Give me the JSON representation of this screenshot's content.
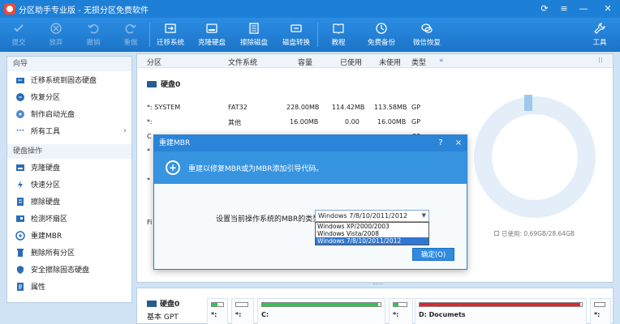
{
  "window": {
    "title": "分区助手专业版 - 无损分区免费软件"
  },
  "toolbar": {
    "items": [
      {
        "label": "提交",
        "icon": "check-icon",
        "disabled": true
      },
      {
        "label": "放弃",
        "icon": "cancel-icon",
        "disabled": true
      },
      {
        "label": "撤销",
        "icon": "undo-icon",
        "disabled": true
      },
      {
        "label": "重做",
        "icon": "redo-icon",
        "disabled": true
      },
      {
        "label": "迁移系统",
        "icon": "migrate-os-icon",
        "disabled": false
      },
      {
        "label": "克隆硬盘",
        "icon": "clone-disk-icon",
        "disabled": false
      },
      {
        "label": "擦除磁盘",
        "icon": "wipe-disk-icon",
        "disabled": false
      },
      {
        "label": "磁盘转换",
        "icon": "disk-convert-icon",
        "disabled": false
      },
      {
        "label": "教程",
        "icon": "tutorial-icon",
        "disabled": false
      },
      {
        "label": "免费备份",
        "icon": "backup-icon",
        "disabled": false
      },
      {
        "label": "微信恢复",
        "icon": "wechat-recover-icon",
        "disabled": false
      },
      {
        "label": "工具",
        "icon": "tools-icon",
        "disabled": false
      }
    ]
  },
  "sidebar": {
    "section1": "向导",
    "wizard_items": [
      {
        "label": "迁移系统到固态硬盘",
        "icon": "migrate-ssd-icon"
      },
      {
        "label": "恢复分区",
        "icon": "recover-partition-icon"
      },
      {
        "label": "制作启动光盘",
        "icon": "boot-disc-icon"
      },
      {
        "label": "所有工具",
        "icon": "more-icon",
        "chevron": "›"
      }
    ],
    "section2": "硬盘操作",
    "disk_items": [
      {
        "label": "克隆硬盘",
        "icon": "clone-disk-icon"
      },
      {
        "label": "快速分区",
        "icon": "quick-partition-icon"
      },
      {
        "label": "擦除硬盘",
        "icon": "wipe-disk-icon"
      },
      {
        "label": "检测坏扇区",
        "icon": "bad-sector-icon"
      },
      {
        "label": "重建MBR",
        "icon": "rebuild-mbr-icon"
      },
      {
        "label": "删除所有分区",
        "icon": "delete-all-icon"
      },
      {
        "label": "安全擦除固态硬盘",
        "icon": "secure-erase-icon"
      },
      {
        "label": "属性",
        "icon": "properties-icon"
      }
    ]
  },
  "table": {
    "headers": [
      "分区",
      "文件系统",
      "容量",
      "已使用",
      "未使用",
      "类型"
    ],
    "disk_label": "硬盘0",
    "rows": [
      {
        "partition": "*: SYSTEM",
        "fs": "FAT32",
        "capacity": "228.00MB",
        "used": "114.42MB",
        "free": "113.58MB",
        "type": "GP"
      },
      {
        "partition": "*:",
        "fs": "其他",
        "capacity": "16.00MB",
        "used": "0.00",
        "free": "16.00MB",
        "type": "GP"
      },
      {
        "partition": "C",
        "fs": "",
        "capacity": "",
        "used": "",
        "free": "",
        "type": "GP"
      },
      {
        "partition": "*",
        "fs": "",
        "capacity": "",
        "used": "",
        "free": "",
        "type": ""
      },
      {
        "partition": "*",
        "fs": "",
        "capacity": "",
        "used": "",
        "free": "",
        "type": ""
      },
      {
        "partition": "Fi",
        "fs": "",
        "capacity": "",
        "used": "",
        "free": "",
        "type": ""
      }
    ],
    "legend": "已使用: 0.69GB/28.64GB"
  },
  "dialog": {
    "title": "重建MBR",
    "help": "?",
    "close": "×",
    "banner": "重建以修复MBR或为MBR添加引导代码。",
    "label": "设置当前操作系统的MBR的类型:",
    "selected": "Windows 7/8/10/2011/2012",
    "options": [
      "Windows XP/2000/2003",
      "Windows Vista/2008",
      "Windows 7/8/10/2011/2012"
    ],
    "ok": "确定(O)"
  },
  "bottom": {
    "disk_name": "硬盘0",
    "disk_type": "基本 GPT",
    "parts": [
      {
        "label": "*:",
        "fill": 0.5,
        "color": "#2dc653"
      },
      {
        "label": "*:",
        "fill": 0,
        "color": "#2dc653"
      },
      {
        "label": "C:",
        "fill": 0.98,
        "color": "#2dc653"
      },
      {
        "label": "*:",
        "fill": 0.4,
        "color": "#2dc653"
      },
      {
        "label": "D: Documets",
        "fill": 0.99,
        "color": "#e0262b"
      },
      {
        "label": "*:",
        "fill": 0,
        "color": "#2dc653"
      }
    ]
  },
  "colors": {
    "titlebar": "#1e7fd6",
    "accent": "#2a85d8",
    "used_green": "#2dc653",
    "used_red": "#e0262b"
  }
}
